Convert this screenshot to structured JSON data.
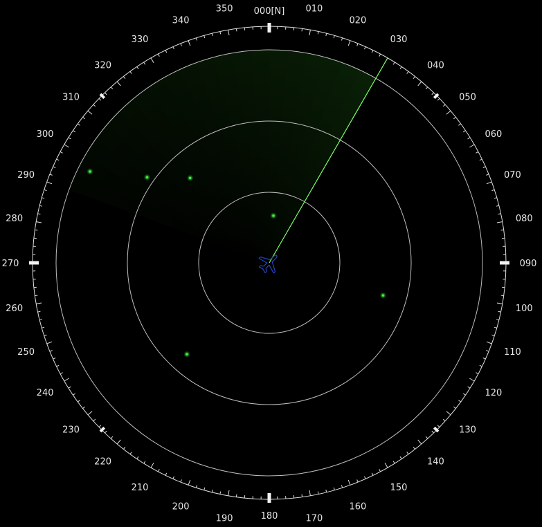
{
  "colors": {
    "background": "#000000",
    "ring": "#bfbfbf",
    "scale": "#e0e0e0",
    "sweep_line": "#7dff6a",
    "sweep_trail": "#1f6b14",
    "echo": "#3cff3c",
    "ownship": "#2244cc"
  },
  "compass": {
    "labels": [
      {
        "bearing": 0,
        "text": "000[N]"
      },
      {
        "bearing": 10,
        "text": "010"
      },
      {
        "bearing": 20,
        "text": "020"
      },
      {
        "bearing": 30,
        "text": "030"
      },
      {
        "bearing": 40,
        "text": "040"
      },
      {
        "bearing": 50,
        "text": "050"
      },
      {
        "bearing": 60,
        "text": "060"
      },
      {
        "bearing": 70,
        "text": "070"
      },
      {
        "bearing": 80,
        "text": "080"
      },
      {
        "bearing": 90,
        "text": "090"
      },
      {
        "bearing": 100,
        "text": "100"
      },
      {
        "bearing": 110,
        "text": "110"
      },
      {
        "bearing": 120,
        "text": "120"
      },
      {
        "bearing": 130,
        "text": "130"
      },
      {
        "bearing": 140,
        "text": "140"
      },
      {
        "bearing": 150,
        "text": "150"
      },
      {
        "bearing": 160,
        "text": "160"
      },
      {
        "bearing": 170,
        "text": "170"
      },
      {
        "bearing": 180,
        "text": "180"
      },
      {
        "bearing": 190,
        "text": "190"
      },
      {
        "bearing": 200,
        "text": "200"
      },
      {
        "bearing": 210,
        "text": "210"
      },
      {
        "bearing": 220,
        "text": "220"
      },
      {
        "bearing": 230,
        "text": "230"
      },
      {
        "bearing": 240,
        "text": "240"
      },
      {
        "bearing": 250,
        "text": "250"
      },
      {
        "bearing": 260,
        "text": "260"
      },
      {
        "bearing": 270,
        "text": "270"
      },
      {
        "bearing": 280,
        "text": "280"
      },
      {
        "bearing": 290,
        "text": "290"
      },
      {
        "bearing": 300,
        "text": "300"
      },
      {
        "bearing": 310,
        "text": "310"
      },
      {
        "bearing": 320,
        "text": "320"
      },
      {
        "bearing": 330,
        "text": "330"
      },
      {
        "bearing": 340,
        "text": "340"
      },
      {
        "bearing": 350,
        "text": "350"
      }
    ],
    "cardinal_marks": [
      0,
      90,
      180,
      270
    ],
    "intercardinal_marks": [
      45,
      135,
      225,
      315
    ]
  },
  "sweep": {
    "bearing": 30,
    "trail_start_bearing": 290
  },
  "echoes": [
    {
      "bearing": 5,
      "range": 0.2
    },
    {
      "bearing": 317,
      "range": 0.49
    },
    {
      "bearing": 305,
      "range": 0.63
    },
    {
      "bearing": 297,
      "range": 0.85
    },
    {
      "bearing": 222,
      "range": 0.52
    },
    {
      "bearing": 106,
      "range": 0.5
    }
  ],
  "ownship": {
    "icon": "airplane-icon",
    "heading": 45
  }
}
